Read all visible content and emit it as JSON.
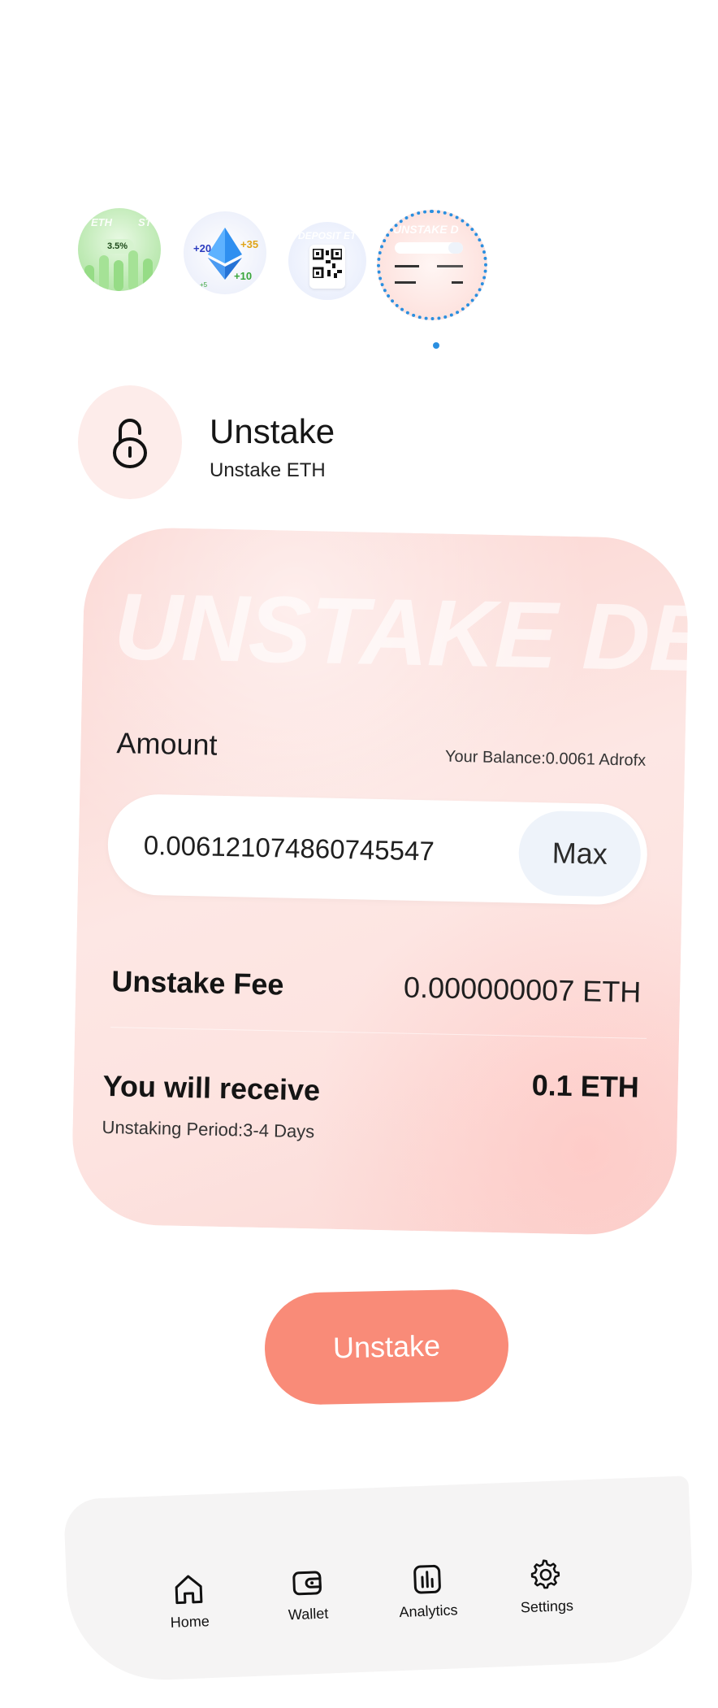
{
  "carousel": {
    "slides": [
      {
        "name": "staking-slide",
        "text_left": "ETH",
        "text_right": "ST",
        "badge": "3.5%"
      },
      {
        "name": "eth-rewards-slide",
        "labels": [
          "+20",
          "+35",
          "+10",
          "+5"
        ]
      },
      {
        "name": "deposit-slide",
        "title": "DEPOSIT ET"
      },
      {
        "name": "unstake-slide",
        "title": "UNSTAKE D",
        "selected": true
      }
    ]
  },
  "header": {
    "title": "Unstake",
    "subtitle": "Unstake ETH"
  },
  "card": {
    "watermark": "UNSTAKE DEP",
    "amount_label": "Amount",
    "balance": "Your Balance:0.0061 Adrofx",
    "amount_value": "0.006121074860745547",
    "max_label": "Max",
    "fee_label": "Unstake Fee",
    "fee_value": "0.000000007 ETH",
    "receive_label": "You will receive",
    "receive_value": "0.1 ETH",
    "period": "Unstaking Period:3-4 Days"
  },
  "actions": {
    "unstake_label": "Unstake"
  },
  "nav": {
    "items": [
      {
        "label": "Home",
        "icon": "home-icon"
      },
      {
        "label": "Wallet",
        "icon": "wallet-icon"
      },
      {
        "label": "Analytics",
        "icon": "analytics-icon"
      },
      {
        "label": "Settings",
        "icon": "gear-icon"
      }
    ]
  },
  "colors": {
    "accent": "#f98b78",
    "card": "#fde3e0",
    "indicator": "#2a8fe0"
  }
}
